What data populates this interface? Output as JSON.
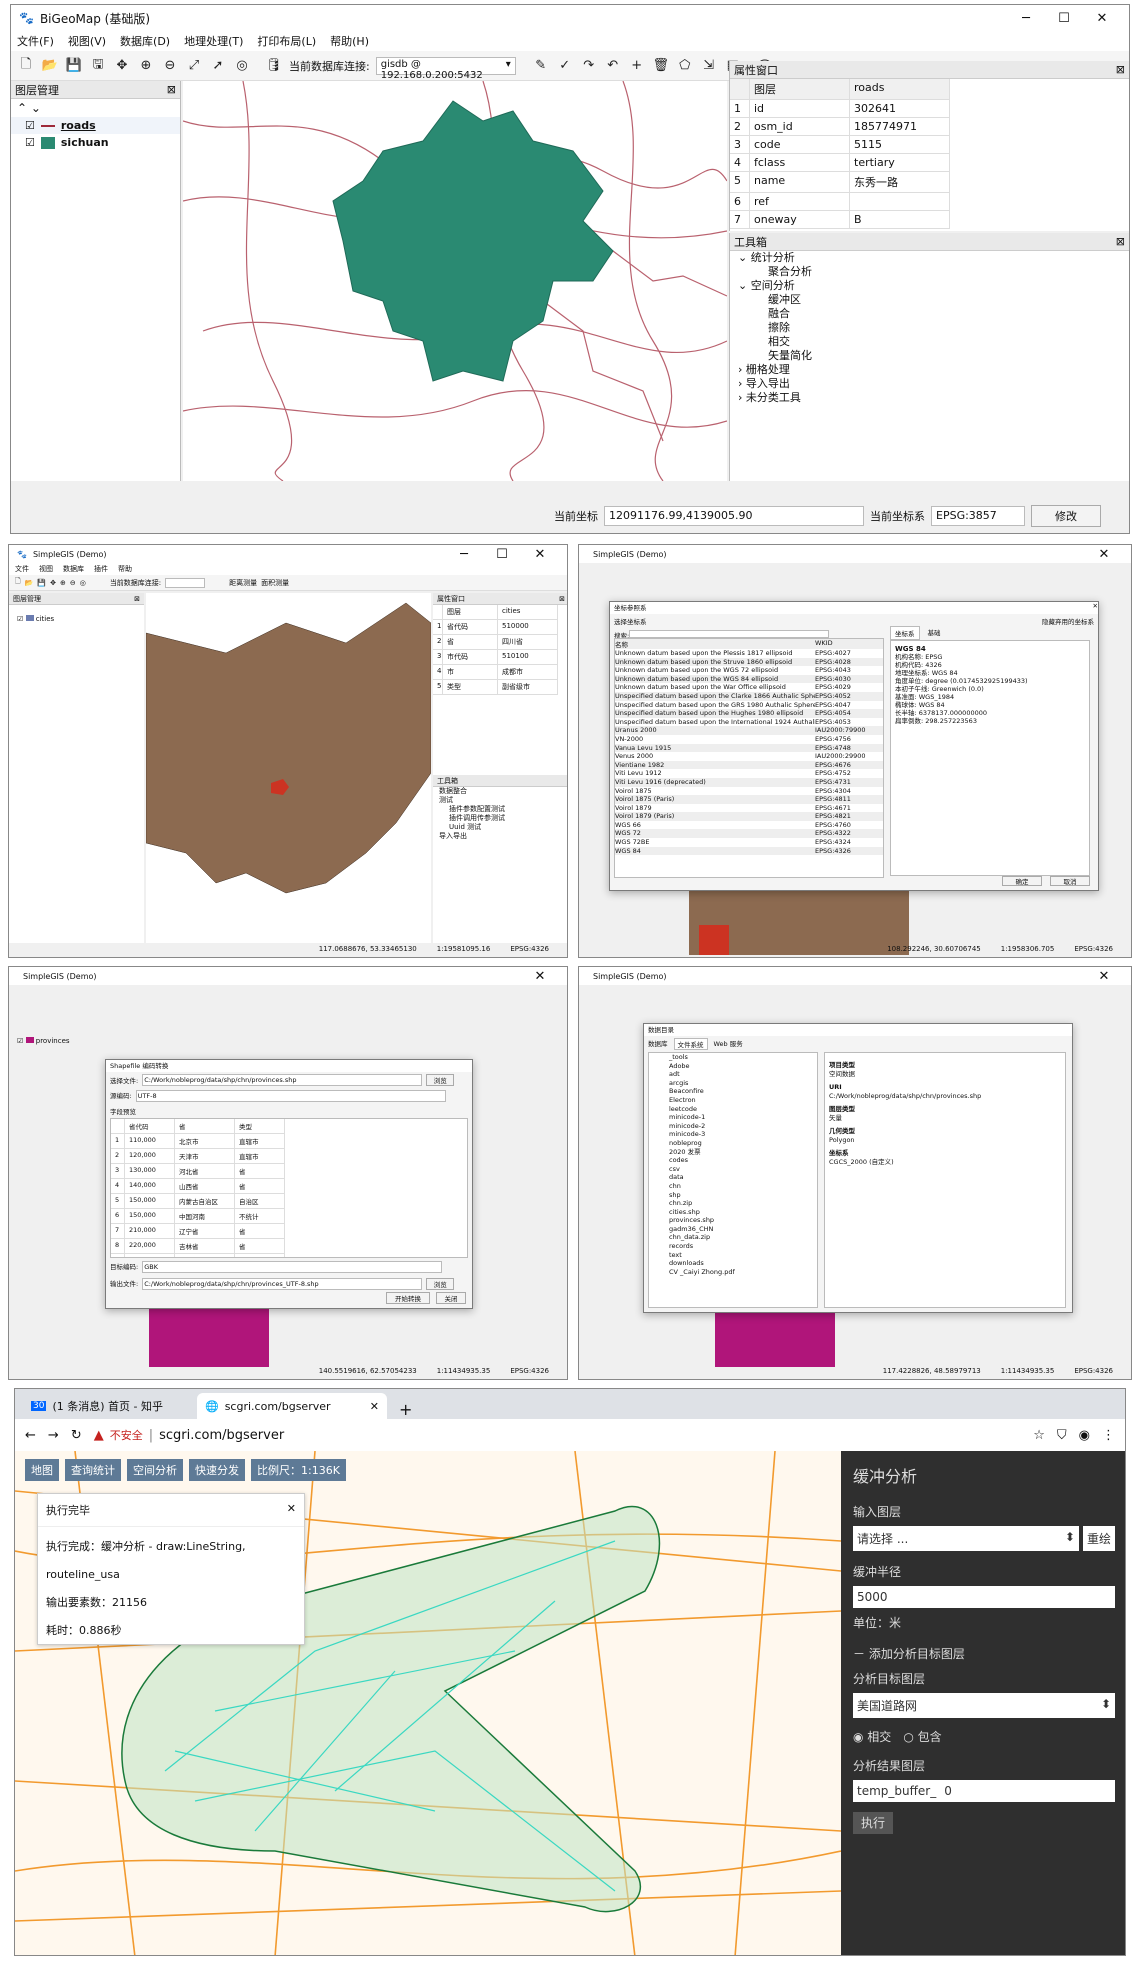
{
  "w1": {
    "title": "BiGeoMap (基础版)",
    "menus": [
      "文件(F)",
      "视图(V)",
      "数据库(D)",
      "地理处理(T)",
      "打印布局(L)",
      "帮助(H)"
    ],
    "db_label": "当前数据库连接:",
    "db_value": "gisdb @ 192.168.0.200:5432",
    "layers_title": "图层管理",
    "layers": [
      {
        "name": "roads",
        "color": "#9e2a3a"
      },
      {
        "name": "sichuan",
        "color": "#2a8a72"
      }
    ],
    "attr_title": "属性窗口",
    "attr_head": [
      "图层",
      "roads"
    ],
    "attr_rows": [
      [
        "1",
        "id",
        "302641"
      ],
      [
        "2",
        "osm_id",
        "185774971"
      ],
      [
        "3",
        "code",
        "5115"
      ],
      [
        "4",
        "fclass",
        "tertiary"
      ],
      [
        "5",
        "name",
        "东秀一路"
      ],
      [
        "6",
        "ref",
        ""
      ],
      [
        "7",
        "oneway",
        "B"
      ]
    ],
    "toolbox_title": "工具箱",
    "toolbox": [
      "统计分析",
      "聚合分析",
      "空间分析",
      "缓冲区",
      "融合",
      "擦除",
      "相交",
      "矢量简化",
      "栅格处理",
      "导入导出",
      "未分类工具"
    ],
    "coord_label": "当前坐标",
    "coord_value": "12091176.99,4139005.90",
    "crs_label": "当前坐标系",
    "crs_value": "EPSG:3857",
    "modify": "修改"
  },
  "w2": {
    "title": "SimpleGIS (Demo)",
    "menus": [
      "文件",
      "视图",
      "数据库",
      "插件",
      "帮助"
    ],
    "db": "当前数据库连接:",
    "tools": [
      "距离测量",
      "面积测量"
    ],
    "layer": "cities",
    "layers_title": "图层管理",
    "attr_title": "属性窗口",
    "attr_head": [
      "图层",
      "cities"
    ],
    "attr_rows": [
      [
        "1",
        "省代码",
        "510000"
      ],
      [
        "2",
        "省",
        "四川省"
      ],
      [
        "3",
        "市代码",
        "510100"
      ],
      [
        "4",
        "市",
        "成都市"
      ],
      [
        "5",
        "类型",
        "副省级市"
      ]
    ],
    "toolbox_title": "工具箱",
    "toolbox": [
      "数据整合",
      "测试",
      "插件参数配置测试",
      "插件调用传参测试",
      "Uuid 测试",
      "导入导出"
    ],
    "status": [
      "117.0688676, 53.33465130",
      "1:19581095.16",
      "EPSG:4326"
    ]
  },
  "w3": {
    "title": "SimpleGIS (Demo)",
    "dlg_title": "坐标参照系",
    "left_title": "选择坐标系",
    "search_label": "搜索:",
    "hide_deprecated": "隐藏弃用的坐标系",
    "col_name": "名称",
    "col_wkid": "WKID",
    "rows": [
      [
        "Unknown datum based upon the Plessis 1817 ellipsoid",
        "EPSG:4027"
      ],
      [
        "Unknown datum based upon the Struve 1860 ellipsoid",
        "EPSG:4028"
      ],
      [
        "Unknown datum based upon the WGS 72 ellipsoid",
        "EPSG:4043"
      ],
      [
        "Unknown datum based upon the WGS 84 ellipsoid",
        "EPSG:4030"
      ],
      [
        "Unknown datum based upon the War Office ellipsoid",
        "EPSG:4029"
      ],
      [
        "Unspecified datum based upon the Clarke 1866 Authalic Sphere",
        "EPSG:4052"
      ],
      [
        "Unspecified datum based upon the GRS 1980 Authalic Sphere",
        "EPSG:4047"
      ],
      [
        "Unspecified datum based upon the Hughes 1980 ellipsoid",
        "EPSG:4054"
      ],
      [
        "Unspecified datum based upon the International 1924 Authalic...",
        "EPSG:4053"
      ],
      [
        "Uranus 2000",
        "IAU2000:79900"
      ],
      [
        "VN-2000",
        "EPSG:4756"
      ],
      [
        "Vanua Levu 1915",
        "EPSG:4748"
      ],
      [
        "Venus 2000",
        "IAU2000:29900"
      ],
      [
        "Vientiane 1982",
        "EPSG:4676"
      ],
      [
        "Viti Levu 1912",
        "EPSG:4752"
      ],
      [
        "Viti Levu 1916 (deprecated)",
        "EPSG:4731"
      ],
      [
        "Voirol 1875",
        "EPSG:4304"
      ],
      [
        "Voirol 1875 (Paris)",
        "EPSG:4811"
      ],
      [
        "Voirol 1879",
        "EPSG:4671"
      ],
      [
        "Voirol 1879 (Paris)",
        "EPSG:4821"
      ],
      [
        "WGS 66",
        "EPSG:4760"
      ],
      [
        "WGS 72",
        "EPSG:4322"
      ],
      [
        "WGS 72BE",
        "EPSG:4324"
      ],
      [
        "WGS 84",
        "EPSG:4326"
      ]
    ],
    "tabs": [
      "坐标系",
      "基础"
    ],
    "detail_title": "WGS 84",
    "detail": [
      "机构名称: EPSG",
      "机构代码: 4326",
      "",
      "地理坐标系: WGS 84",
      "角度单位: degree (0.0174532925199433)",
      "本初子午线: Greenwich (0.0)",
      "基准面: WGS_1984",
      "椭球体: WGS 84",
      "长半轴: 6378137.000000000",
      "扁率倒数: 298.257223563"
    ],
    "ok": "确定",
    "cancel": "取消",
    "status": [
      "108.292246, 30.60706745",
      "1:1958306.705",
      "EPSG:4326"
    ]
  },
  "w4": {
    "title": "SimpleGIS (Demo)",
    "dlg_title": "Shapefile 编码转换",
    "choose_label": "选择文件:",
    "choose_value": "C:/Work/nobleprog/data/shp/chn/provinces.shp",
    "browse": "浏览",
    "src_enc_label": "源编码:",
    "src_enc": "UTF-8",
    "field_label": "字段预览",
    "cols": [
      "省代码",
      "省",
      "类型"
    ],
    "rows": [
      [
        "1",
        "110,000",
        "北京市",
        "直辖市"
      ],
      [
        "2",
        "120,000",
        "天津市",
        "直辖市"
      ],
      [
        "3",
        "130,000",
        "河北省",
        "省"
      ],
      [
        "4",
        "140,000",
        "山西省",
        "省"
      ],
      [
        "5",
        "150,000",
        "内蒙古自治区",
        "自治区"
      ],
      [
        "6",
        "150,000",
        "中国河南",
        "不统计"
      ],
      [
        "7",
        "210,000",
        "辽宁省",
        "省"
      ],
      [
        "8",
        "220,000",
        "吉林省",
        "省"
      ],
      [
        "9",
        "230,000",
        "黑龙江省",
        "省"
      ]
    ],
    "target_label": "目标编码:",
    "target": "GBK",
    "out_label": "输出文件:",
    "out_value": "C:/Work/nobleprog/data/shp/chn/provinces_UTF-8.shp",
    "start": "开始转换",
    "close": "关闭",
    "layer": "provinces",
    "status": [
      "140.5519616, 62.57054233",
      "1:11434935.35",
      "EPSG:4326"
    ]
  },
  "w5": {
    "title": "SimpleGIS (Demo)",
    "dlg_title": "数据目录",
    "tabs": [
      "数据库",
      "文件系统",
      "Web 服务"
    ],
    "tree": [
      "_tools",
      "Adobe",
      "adt",
      "arcgis",
      "Beaconfire",
      "Electron",
      "leetcode",
      "minicode-1",
      "minicode-2",
      "minicode-3",
      "nobleprog",
      "2020 发票",
      "codes",
      "csv",
      "data",
      "chn",
      "shp",
      "chn.zip",
      "cities.shp",
      "provinces.shp",
      "gadm36_CHN",
      "chn_data.zip",
      "records",
      "text",
      "downloads",
      "CV _Caiyi Zhong.pdf"
    ],
    "info": [
      [
        "项目类型",
        "空间数据"
      ],
      [
        "URI",
        "C:/Work/nobleprog/data/shp/chn/provinces.shp"
      ],
      [
        "图层类型",
        "矢量"
      ],
      [
        "几何类型",
        "Polygon"
      ],
      [
        "坐标系",
        "CGCS_2000 (自定义)"
      ]
    ],
    "status": [
      "117.4228826, 48.58979713",
      "1:11434935.35",
      "EPSG:4326"
    ]
  },
  "w6": {
    "tabs": [
      {
        "label": "(1 条消息) 首页 - 知乎"
      },
      {
        "label": "scgri.com/bgserver"
      }
    ],
    "insecure": "不安全",
    "url": "scgri.com/bgserver",
    "map_buttons": [
      "地图",
      "查询统计",
      "空间分析",
      "快速分发",
      "比例尺：1:136K"
    ],
    "popup_title": "执行完毕",
    "popup_lines": [
      "执行完成：缓冲分析 - draw:LineString, routeline_usa",
      "输出要素数：21156",
      "耗时：0.886秒"
    ],
    "panel": {
      "title": "缓冲分析",
      "input_label": "输入图层",
      "input_value": "请选择 ...",
      "redraw": "重绘",
      "radius_label": "缓冲半径",
      "radius_value": "5000",
      "unit": "单位：米",
      "add_target": "添加分析目标图层",
      "target_label": "分析目标图层",
      "target_value": "美国道路网",
      "opt1": "相交",
      "opt2": "包含",
      "result_label": "分析结果图层",
      "result_value": "temp_buffer_",
      "result_num": "0",
      "run": "执行"
    }
  }
}
